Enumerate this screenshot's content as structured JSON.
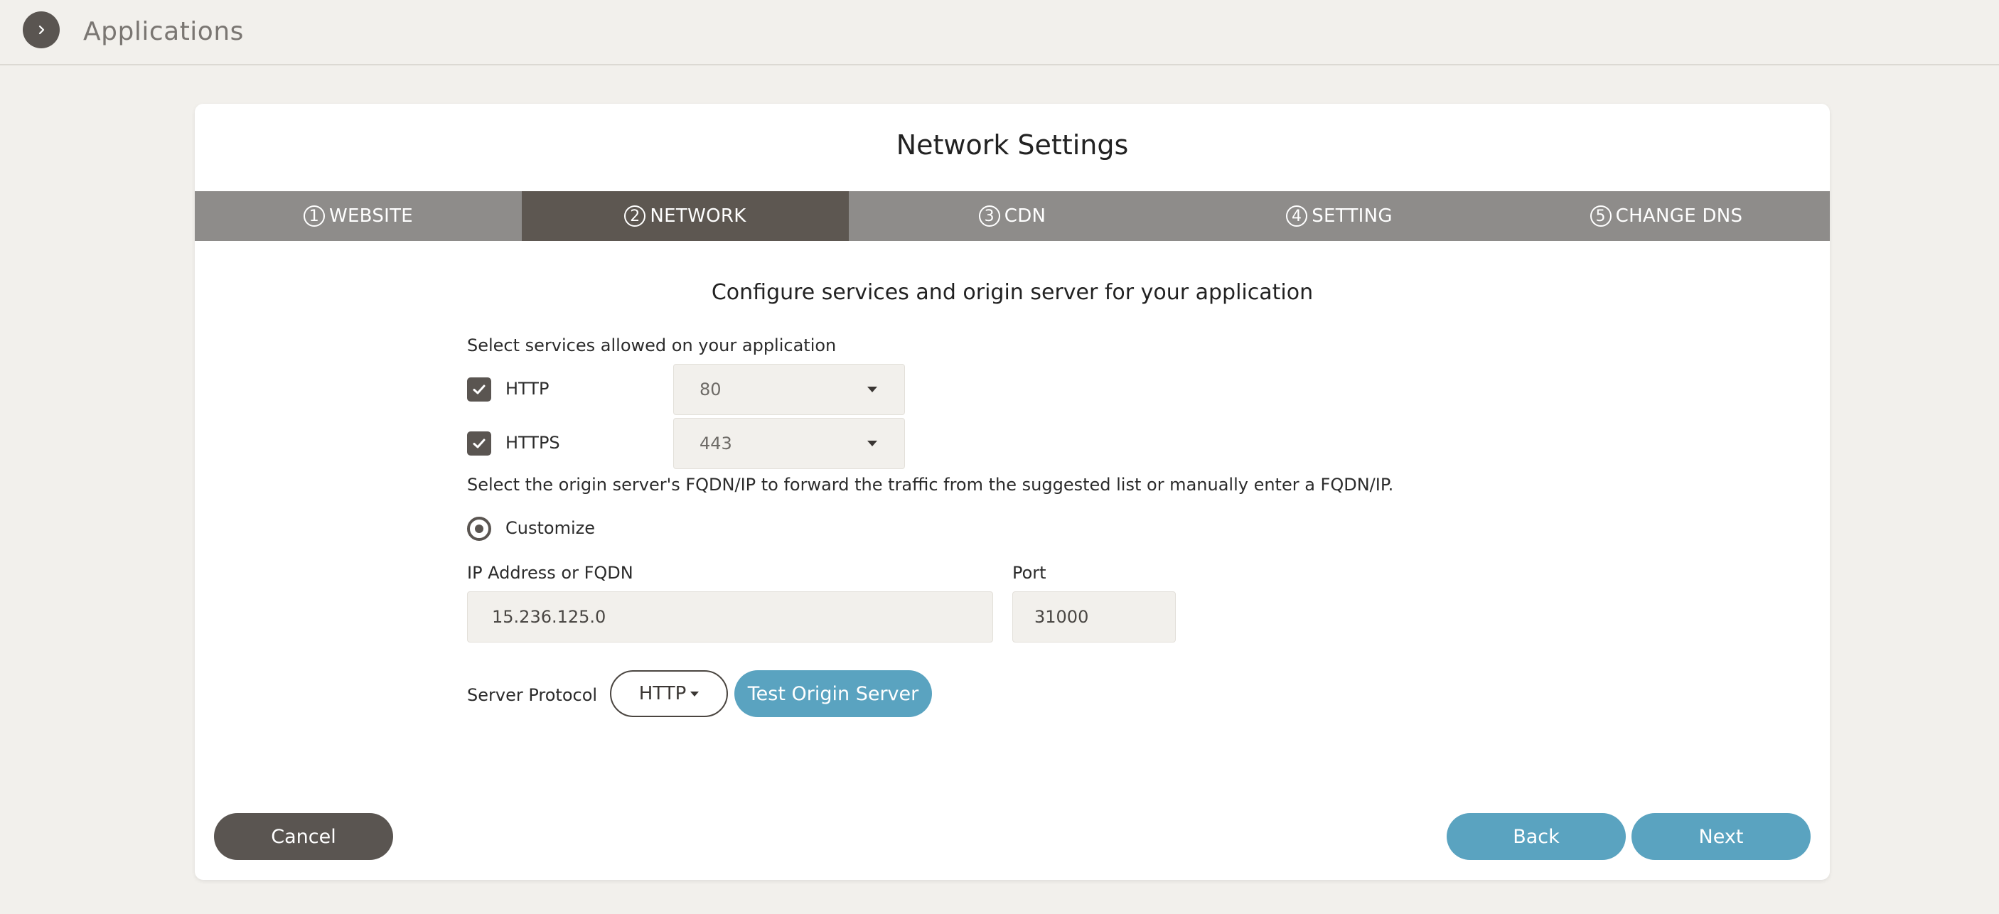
{
  "header": {
    "title": "Applications",
    "expand_icon": "chevron-right-icon"
  },
  "card": {
    "title": "Network Settings",
    "steps": [
      {
        "num": "1",
        "label": "WEBSITE",
        "active": false
      },
      {
        "num": "2",
        "label": "NETWORK",
        "active": true
      },
      {
        "num": "3",
        "label": "CDN",
        "active": false
      },
      {
        "num": "4",
        "label": "SETTING",
        "active": false
      },
      {
        "num": "5",
        "label": "CHANGE DNS",
        "active": false
      }
    ],
    "subtitle": "Configure services and origin server for your application",
    "services": {
      "label": "Select services allowed on your application",
      "items": [
        {
          "name": "HTTP",
          "checked": true,
          "port": "80"
        },
        {
          "name": "HTTPS",
          "checked": true,
          "port": "443"
        }
      ]
    },
    "origin": {
      "instruction": "Select the origin server's FQDN/IP to forward the traffic from the suggested list or manually enter a FQDN/IP.",
      "radio_label": "Customize",
      "ip_label": "IP Address or FQDN",
      "ip_value": "15.236.125.0",
      "port_label": "Port",
      "port_value": "31000",
      "protocol_label": "Server Protocol",
      "protocol_value": "HTTP",
      "test_button": "Test Origin Server"
    },
    "footer": {
      "cancel": "Cancel",
      "back": "Back",
      "next": "Next"
    }
  },
  "colors": {
    "primary_dark": "#5a5551",
    "accent_blue": "#5aa3c0",
    "step_inactive": "#8e8c8a",
    "step_active": "#5d5751",
    "page_bg": "#f2f0ec"
  }
}
